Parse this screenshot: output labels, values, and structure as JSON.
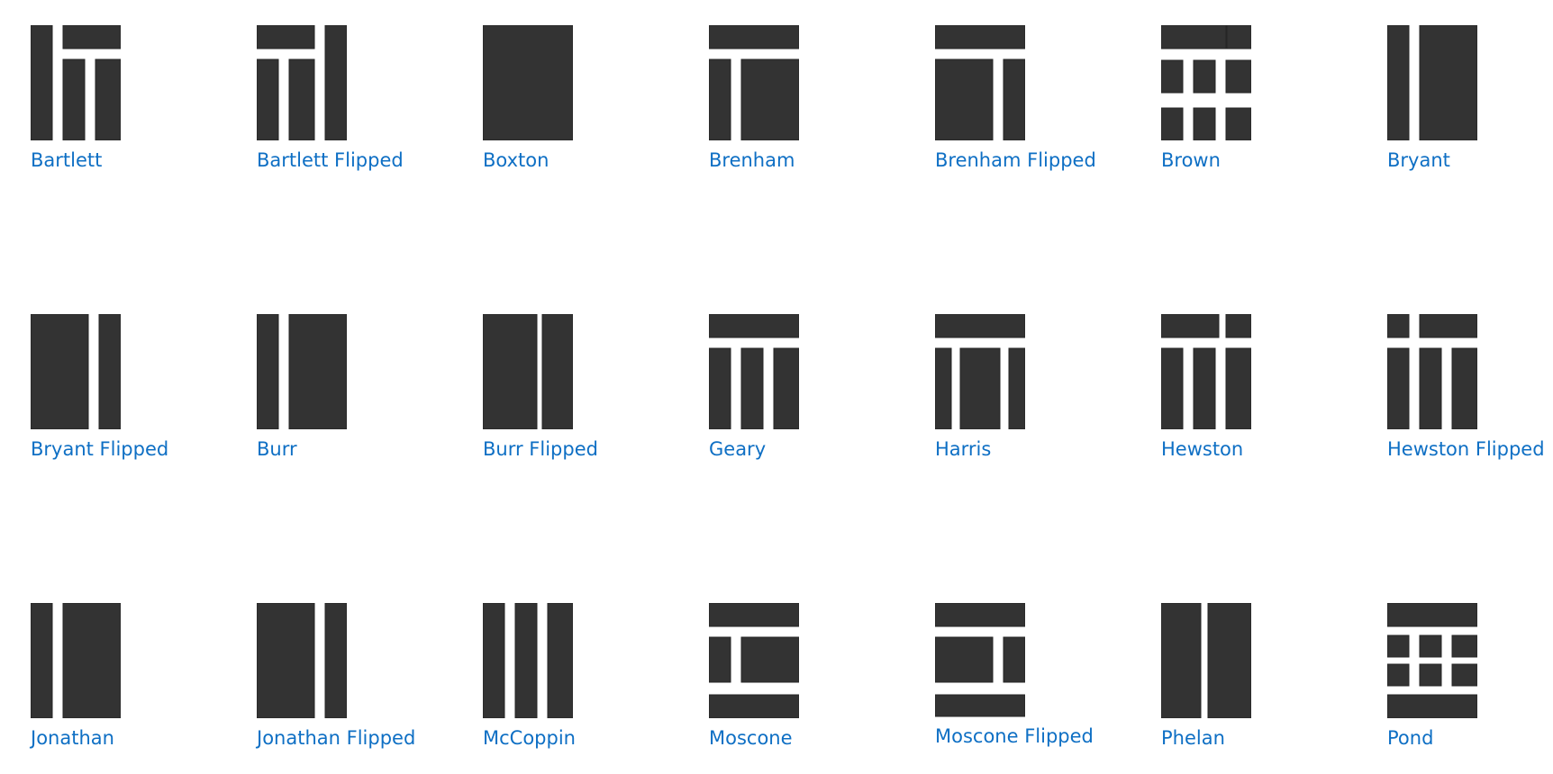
{
  "colors": {
    "thumbnail_fill": "#333333",
    "label_link": "#0e6fc4",
    "background": "#ffffff"
  },
  "layouts": [
    {
      "label": "Bartlett",
      "icon": "layout-bartlett-icon"
    },
    {
      "label": "Bartlett Flipped",
      "icon": "layout-bartlett-flipped-icon"
    },
    {
      "label": "Boxton",
      "icon": "layout-boxton-icon"
    },
    {
      "label": "Brenham",
      "icon": "layout-brenham-icon"
    },
    {
      "label": "Brenham Flipped",
      "icon": "layout-brenham-flipped-icon"
    },
    {
      "label": "Brown",
      "icon": "layout-brown-icon"
    },
    {
      "label": "Bryant",
      "icon": "layout-bryant-icon"
    },
    {
      "label": "Bryant Flipped",
      "icon": "layout-bryant-flipped-icon"
    },
    {
      "label": "Burr",
      "icon": "layout-burr-icon"
    },
    {
      "label": "Burr Flipped",
      "icon": "layout-burr-flipped-icon"
    },
    {
      "label": "Geary",
      "icon": "layout-geary-icon"
    },
    {
      "label": "Harris",
      "icon": "layout-harris-icon"
    },
    {
      "label": "Hewston",
      "icon": "layout-hewston-icon"
    },
    {
      "label": "Hewston Flipped",
      "icon": "layout-hewston-flipped-icon"
    },
    {
      "label": "Jonathan",
      "icon": "layout-jonathan-icon"
    },
    {
      "label": "Jonathan Flipped",
      "icon": "layout-jonathan-flipped-icon"
    },
    {
      "label": "McCoppin",
      "icon": "layout-mccoppin-icon"
    },
    {
      "label": "Moscone",
      "icon": "layout-moscone-icon"
    },
    {
      "label": "Moscone Flipped",
      "icon": "layout-moscone-flipped-icon"
    },
    {
      "label": "Phelan",
      "icon": "layout-phelan-icon"
    },
    {
      "label": "Pond",
      "icon": "layout-pond-icon"
    }
  ]
}
